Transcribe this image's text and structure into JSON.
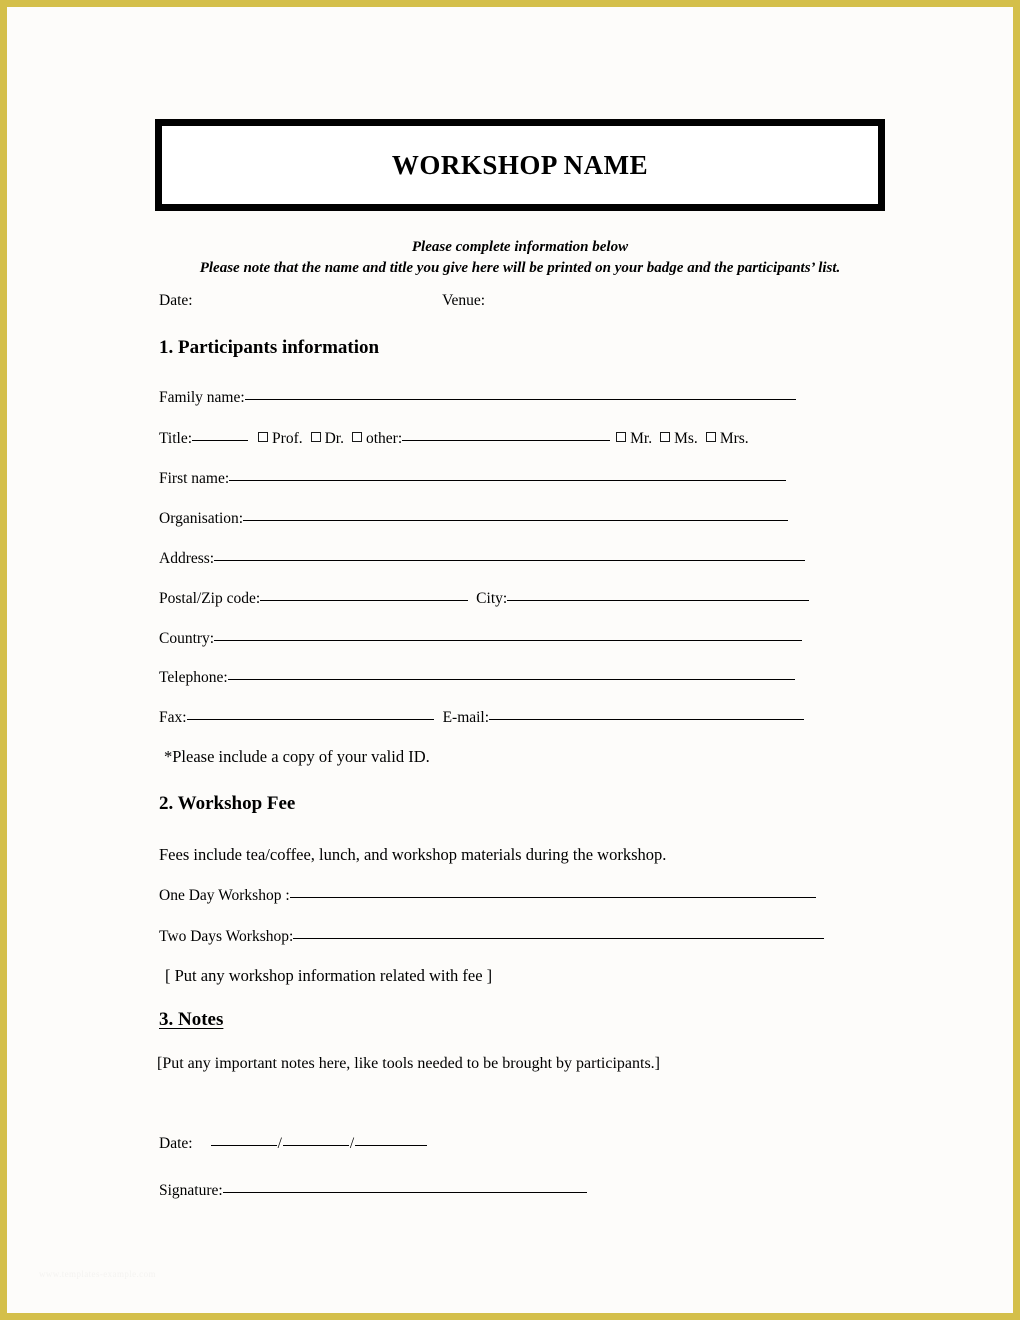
{
  "page": {
    "border_color": "#d4bf4a",
    "paper_color": "#fdfcfa",
    "ink_color": "#000000"
  },
  "header": {
    "title": "WORKSHOP NAME",
    "subtitle_line1": "Please complete information below",
    "subtitle_line2": "Please note that the name and title you give here will be printed on your badge and the participants’ list."
  },
  "top_fields": {
    "date_label": "Date:",
    "venue_label": "Venue:"
  },
  "sections": {
    "participants": {
      "heading": "1. Participants information",
      "fields": {
        "family_name_label": "Family name:",
        "title_label": "Title:",
        "other_label": "other:",
        "first_name_label": "First name:",
        "organisation_label": "Organisation:",
        "address_label": "Address:",
        "postal_label": "Postal/Zip code:",
        "city_label": "City:",
        "country_label": "Country:",
        "telephone_label": "Telephone:",
        "fax_label": "Fax:",
        "email_label": "E-mail:"
      },
      "title_checkboxes_left": [
        "Prof.",
        "Dr."
      ],
      "title_checkboxes_right": [
        "Mr.",
        "Ms.",
        "Mrs."
      ],
      "note": "*Please include a copy of your valid ID."
    },
    "fee": {
      "heading": "2. Workshop Fee",
      "description": "Fees include tea/coffee, lunch, and workshop materials during the workshop.",
      "one_day_label": "One Day Workshop :",
      "two_days_label": "Two Days Workshop:",
      "placeholder_note": "[ Put any workshop information related with fee ]"
    },
    "notes": {
      "heading": "3. Notes",
      "placeholder_note": "[Put any important notes here, like tools needed to be brought by participants.]"
    }
  },
  "signature_block": {
    "date_label": "Date:",
    "date_separator": "/",
    "signature_label": "Signature:"
  },
  "watermark": {
    "text": "www.templates-example.com"
  }
}
